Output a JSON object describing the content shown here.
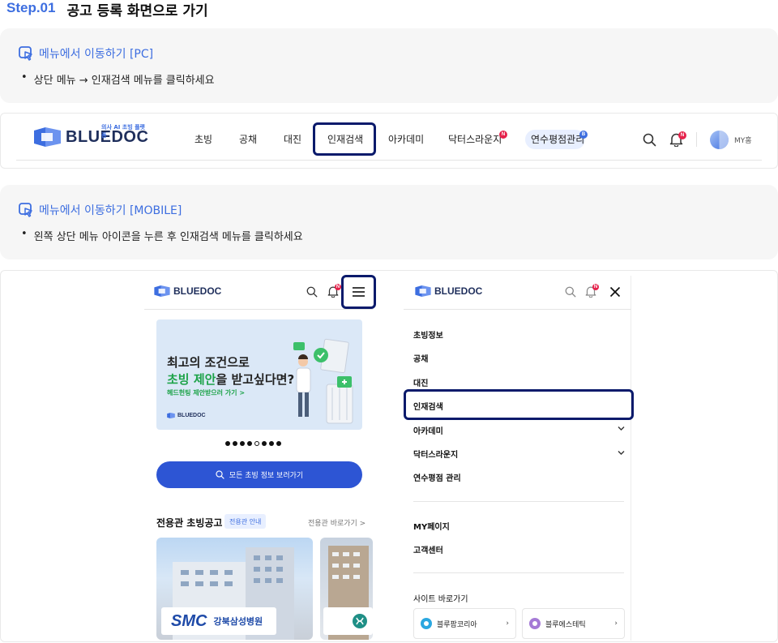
{
  "step": {
    "badge": "Step.01",
    "title": "공고 등록 화면으로 가기"
  },
  "pc_section": {
    "heading": "메뉴에서 이동하기 [PC]",
    "bullet": "상단 메뉴 → 인재검색 메뉴를 클릭하세요"
  },
  "desktop_nav": {
    "logo_text": "BLUEDOC",
    "logo_sub": "의사 AI 초빙 플랫폼",
    "items": [
      "초빙",
      "공채",
      "대진",
      "인재검색",
      "아카데미",
      "닥터스라운지",
      "연수평점관리"
    ],
    "badge_new": "N",
    "badge_b": "B",
    "user_label": "MY홈",
    "accent": "#0a1a6b"
  },
  "mobile_section": {
    "heading": "메뉴에서 이동하기 [MOBILE]",
    "bullet": "왼쪽 상단 메뉴 아이콘을 누른 후 인재검색 메뉴를 클릭하세요"
  },
  "mobile_home": {
    "logo_text": "BLUEDOC",
    "banner": {
      "line1": "최고의 조건으로",
      "line2_green": "초빙 제안",
      "line2_rest": "을 받고싶다면?",
      "cta": "헤드헌팅 제안받으러 가기  >",
      "logo": "BLUEDOC"
    },
    "all_button": "모든 초빙 정보 보러가기",
    "section_title": "전용관 초빙공고",
    "section_tag": "전용관 안내",
    "section_link": "전용관 바로가기 >",
    "card1_logo": "SMC",
    "card1_name": "강북삼성병원"
  },
  "mobile_menu": {
    "logo_text": "BLUEDOC",
    "items": [
      "초빙정보",
      "공채",
      "대진",
      "인재검색",
      "아카데미",
      "닥터스라운지",
      "연수평점 관리"
    ],
    "items2": [
      "MY페이지",
      "고객센터"
    ],
    "sites_label": "사이트 바로가기",
    "site1": "블루팜코리아",
    "site2": "블루에스테틱"
  }
}
